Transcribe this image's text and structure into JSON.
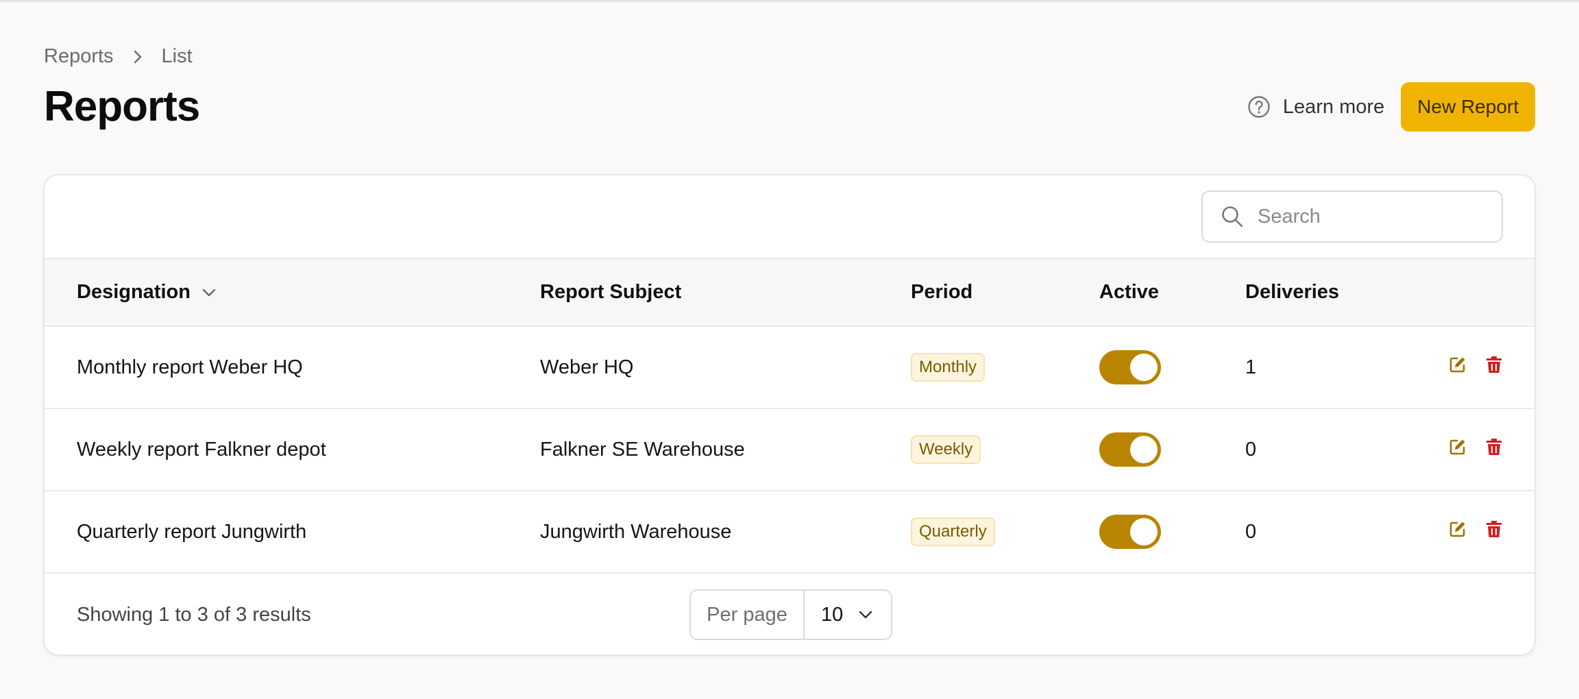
{
  "breadcrumb": {
    "root": "Reports",
    "current": "List"
  },
  "page": {
    "title": "Reports"
  },
  "header": {
    "learn_more": "Learn more",
    "new_report": "New Report"
  },
  "search": {
    "placeholder": "Search",
    "value": ""
  },
  "table": {
    "columns": {
      "designation": "Designation",
      "subject": "Report Subject",
      "period": "Period",
      "active": "Active",
      "deliveries": "Deliveries"
    },
    "rows": [
      {
        "designation": "Monthly report Weber HQ",
        "subject": "Weber HQ",
        "period": "Monthly",
        "active": true,
        "deliveries": "1"
      },
      {
        "designation": "Weekly report Falkner depot",
        "subject": "Falkner SE Warehouse",
        "period": "Weekly",
        "active": true,
        "deliveries": "0"
      },
      {
        "designation": "Quarterly report Jungwirth",
        "subject": "Jungwirth Warehouse",
        "period": "Quarterly",
        "active": true,
        "deliveries": "0"
      }
    ]
  },
  "footer": {
    "results": "Showing 1 to 3 of 3 results",
    "per_page_label": "Per page",
    "per_page_value": "10"
  },
  "colors": {
    "accent": "#f0b400",
    "toggle_on": "#b98500",
    "edit_icon": "#a07200",
    "delete_icon": "#d42020",
    "badge_bg": "#fdf4dd",
    "badge_text": "#7a5a00"
  },
  "icons": {
    "breadcrumb_separator": "chevron-right-icon",
    "learn_more": "question-circle-icon",
    "search": "search-icon",
    "sort": "chevron-down-icon",
    "edit": "edit-icon",
    "delete": "trash-icon",
    "per_page": "chevron-down-icon"
  }
}
